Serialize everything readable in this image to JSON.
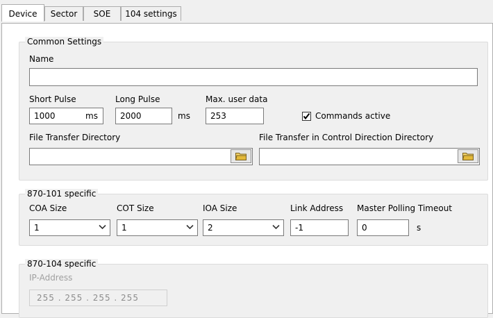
{
  "tabs": [
    "Device",
    "Sector",
    "SOE",
    "104 settings"
  ],
  "common": {
    "legend": "Common Settings",
    "name_label": "Name",
    "name_value": "",
    "short_pulse_label": "Short Pulse",
    "short_pulse_value": "1000",
    "short_pulse_unit": "ms",
    "long_pulse_label": "Long Pulse",
    "long_pulse_value": "2000",
    "long_pulse_unit": "ms",
    "max_user_data_label": "Max. user data",
    "max_user_data_value": "253",
    "commands_active_label": "Commands active",
    "commands_active_checked": true,
    "file_transfer_label": "File Transfer Directory",
    "file_transfer_value": "",
    "file_transfer_control_label": "File Transfer in Control Direction Directory",
    "file_transfer_control_value": ""
  },
  "spec101": {
    "legend": "870-101 specific",
    "coa_label": "COA Size",
    "coa_value": "1",
    "cot_label": "COT Size",
    "cot_value": "1",
    "ioa_label": "IOA Size",
    "ioa_value": "2",
    "link_label": "Link Address",
    "link_value": "-1",
    "mpt_label": "Master Polling Timeout",
    "mpt_value": "0",
    "mpt_unit": "s"
  },
  "spec104": {
    "legend": "870-104 specific",
    "ip_label": "IP-Address",
    "ip_value": "255  .  255  .  255  .  255"
  }
}
